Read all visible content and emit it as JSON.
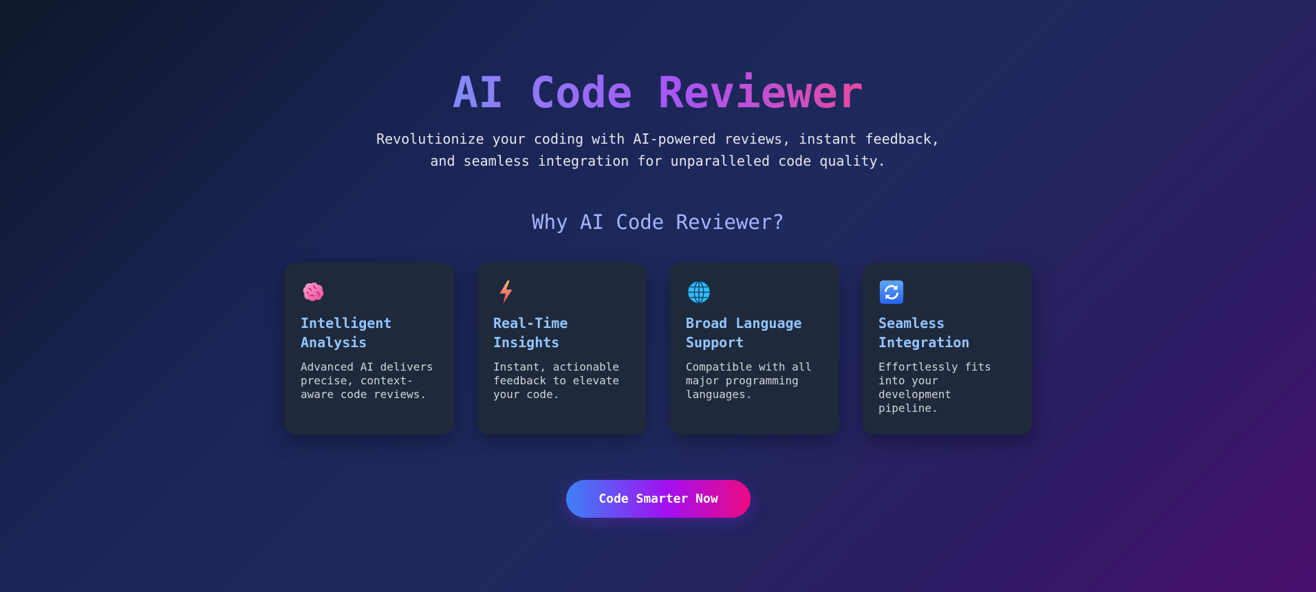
{
  "hero": {
    "title": "AI Code Reviewer",
    "subtitle_line1": "Revolutionize your coding with AI-powered reviews, instant feedback,",
    "subtitle_line2": "and seamless integration for unparalleled code quality."
  },
  "features": {
    "heading": "Why AI Code Reviewer?",
    "cards": [
      {
        "icon": "brain-icon",
        "title": "Intelligent Analysis",
        "text": "Advanced AI delivers precise, context-aware code reviews."
      },
      {
        "icon": "lightning-icon",
        "title": "Real-Time Insights",
        "text": "Instant, actionable feedback to elevate your code."
      },
      {
        "icon": "globe-icon",
        "title": "Broad Language Support",
        "text": "Compatible with all major programming languages."
      },
      {
        "icon": "refresh-icon",
        "title": "Seamless Integration",
        "text": "Effortlessly fits into your development pipeline."
      }
    ]
  },
  "cta": {
    "label": "Code Smarter Now"
  },
  "colors": {
    "accent_title_start": "#818cf8",
    "accent_title_mid": "#a855f7",
    "accent_title_end": "#ec4899",
    "card_bg": "#1e293b",
    "card_title": "#93c5fd",
    "section_title": "#a5b4fc"
  }
}
